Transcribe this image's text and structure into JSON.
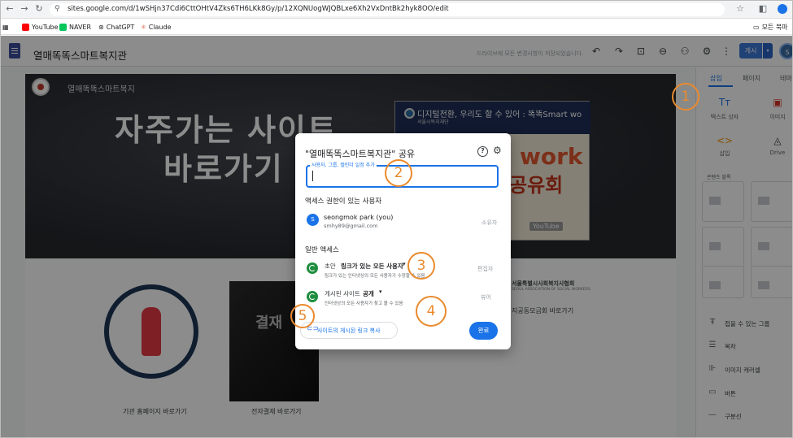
{
  "browser": {
    "url": "sites.google.com/d/1wSHjn37Cdi6CttOHtV4Zks6TH6LKk8Gy/p/12XQNUogWJQBLxe6Xh2VxDntBk2hyk8OO/edit",
    "bookmarks": [
      "YouTube",
      "NAVER",
      "ChatGPT",
      "Claude"
    ],
    "all_bookmarks": "모든 북마"
  },
  "header": {
    "site_name": "열매똑똑스마트복지관",
    "save_status": "드라이브에 모든 변경사항이 저장되었습니다.",
    "publish_label": "게시",
    "avatar_letter": "S"
  },
  "canvas": {
    "hero_site_name": "열매똑똑스마트복지",
    "hero_title_line1": "자주가는 사이트",
    "hero_title_line2": "바로가기",
    "banner_title": "디지털전환, 우리도 할 수 있어 : 똑똑Smart wo",
    "banner_sub": "서울시복지재단",
    "banner_big1": "work",
    "banner_big2": "공유회",
    "banner_video": "YouTube",
    "book_text": "결재",
    "label_homepage": "기관 홈페이지 바로가기",
    "label_ebook": "전자결재 바로가기",
    "label_assoc": "서울특별시사회복지사협회",
    "label_assoc_sub": "SEOUL ASSOCIATION OF SOCIAL WORKERS",
    "label_fund": "지공동모금회 바로가기"
  },
  "panel": {
    "tabs": [
      "삽입",
      "페이지",
      "테마"
    ],
    "insert_items": [
      {
        "icon": "Tт",
        "label": "텍스트 상자"
      },
      {
        "icon": "▣",
        "label": "이미지"
      },
      {
        "icon": "<>",
        "label": "삽입"
      },
      {
        "icon": "◬",
        "label": "Drive"
      }
    ],
    "content_blocks_label": "콘텐츠 블록",
    "list_items": [
      {
        "icon": "Ŧ",
        "label": "접을 수 있는 그룹"
      },
      {
        "icon": "☰",
        "label": "목차"
      },
      {
        "icon": "⊪",
        "label": "이미지 캐러셀"
      },
      {
        "icon": "▭",
        "label": "버튼"
      },
      {
        "icon": "—",
        "label": "구분선"
      }
    ]
  },
  "dialog": {
    "title": "\"열매똑똑스마트복지관\" 공유",
    "input_label": "사용자, 그룹, 캘린더 일정 추가",
    "access_heading": "액세스 권한이 있는 사용자",
    "user": {
      "initial": "S",
      "name": "seongmok park (you)",
      "email": "smhy89@gmail.com",
      "role": "소유자"
    },
    "general_heading": "일반 액세스",
    "draft": {
      "label": "초안",
      "value": "링크가 있는 모든 사용자",
      "desc": "링크가 있는 인터넷상의 모든 사용자가 수정할 수 있음",
      "role": "편집자"
    },
    "published": {
      "label": "게시된 사이트",
      "value": "공개",
      "desc": "인터넷상의 모든 사용자가 찾고 볼 수 있음",
      "role": "뷰어"
    },
    "copy_link_label": "사이트의 게시된 링크 복사",
    "done_label": "완료"
  },
  "callouts": [
    "1",
    "2",
    "3",
    "4",
    "5"
  ],
  "colors": {
    "accent": "#1a73e8",
    "callout": "#ea8a2e",
    "globe": "#1e8e3e",
    "hero": "#2b2d31"
  }
}
